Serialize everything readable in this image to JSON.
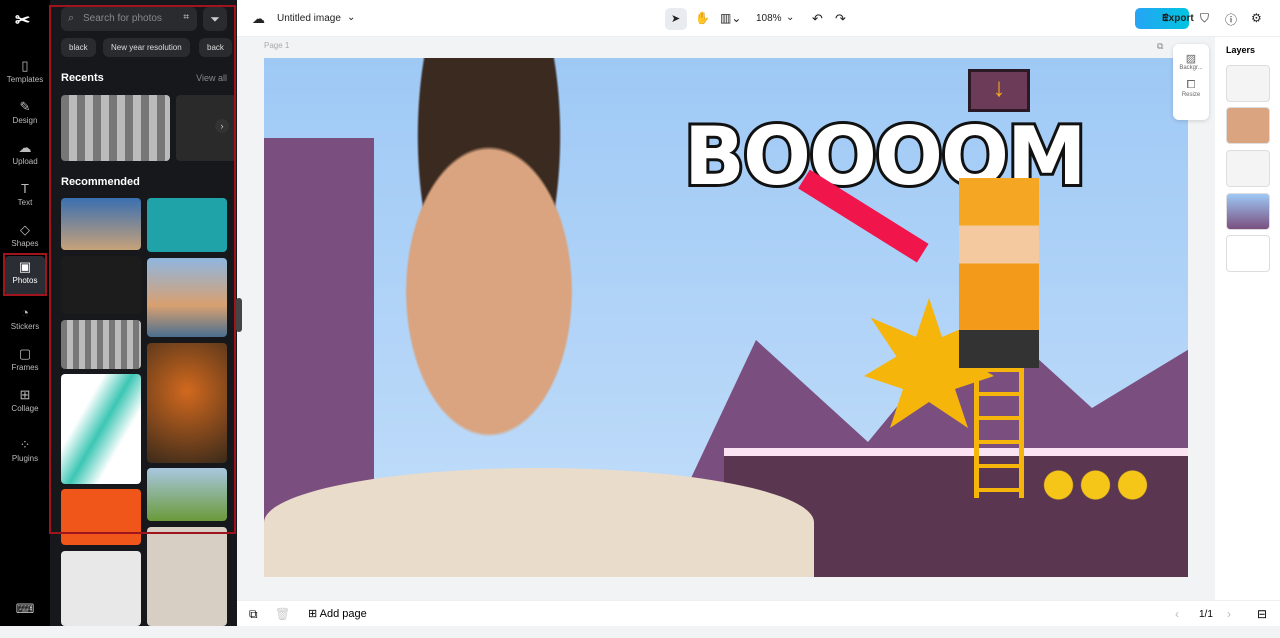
{
  "nav": {
    "items": [
      {
        "label": "Templates",
        "icon": "templates-icon"
      },
      {
        "label": "Design",
        "icon": "design-icon"
      },
      {
        "label": "Upload",
        "icon": "upload-icon"
      },
      {
        "label": "Text",
        "icon": "text-icon"
      },
      {
        "label": "Shapes",
        "icon": "shapes-icon"
      },
      {
        "label": "Photos",
        "icon": "photos-icon"
      },
      {
        "label": "Stickers",
        "icon": "stickers-icon"
      },
      {
        "label": "Frames",
        "icon": "frames-icon"
      },
      {
        "label": "Collage",
        "icon": "collage-icon"
      },
      {
        "label": "Plugins",
        "icon": "plugins-icon"
      }
    ]
  },
  "panel": {
    "search_placeholder": "Search for photos",
    "chips": [
      "black",
      "New year resolution",
      "back"
    ],
    "recents": "Recents",
    "view_all": "View all",
    "recommended": "Recommended"
  },
  "top": {
    "title": "Untitled image",
    "zoom": "108%",
    "export": "Export"
  },
  "canvas": {
    "page_label": "Page 1",
    "headline": "BOOOOM"
  },
  "float": {
    "background": "Backgr...",
    "resize": "Resize"
  },
  "layers": {
    "title": "Layers"
  },
  "bottom": {
    "add_page": "Add page",
    "pager": "1/1"
  },
  "colors": {
    "accent": "#27a4f5",
    "annotation": "#a0141e"
  }
}
